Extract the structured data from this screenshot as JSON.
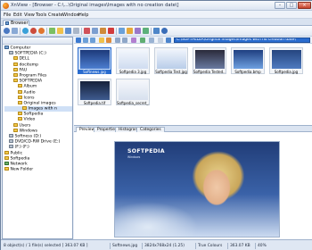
{
  "window": {
    "title": "XnView - [Browser - C:\\...\\Original images\\Images with no creation date\\]"
  },
  "menubar": [
    "File",
    "Edit",
    "View",
    "Tools",
    "Create",
    "Window",
    "Help"
  ],
  "tabs": [
    {
      "label": "Browser"
    }
  ],
  "address": "C:\\SOFTPEDIA\\Original images\\Images with no creation date\\",
  "tree": [
    {
      "label": "Computer",
      "icon": "computer-icon",
      "level": 0
    },
    {
      "label": "SOFTPEDIA (C:)",
      "icon": "drive-icon",
      "level": 1
    },
    {
      "label": "DELL",
      "icon": "folder-icon",
      "level": 2
    },
    {
      "label": "docitemp",
      "icon": "folder-icon",
      "level": 2
    },
    {
      "label": "FAU",
      "icon": "folder-icon",
      "level": 2
    },
    {
      "label": "Program Files",
      "icon": "folder-icon",
      "level": 2
    },
    {
      "label": "SOFTPEDIA",
      "icon": "folder-icon",
      "level": 2
    },
    {
      "label": "Album",
      "icon": "folder-icon",
      "level": 3
    },
    {
      "label": "Audio",
      "icon": "folder-icon",
      "level": 3
    },
    {
      "label": "Icons",
      "icon": "folder-icon",
      "level": 3
    },
    {
      "label": "Original images",
      "icon": "folder-icon",
      "level": 3
    },
    {
      "label": "Images with n",
      "icon": "folder-icon",
      "level": 4,
      "selected": true
    },
    {
      "label": "Softpedia",
      "icon": "folder-icon",
      "level": 3
    },
    {
      "label": "Video",
      "icon": "folder-icon",
      "level": 3
    },
    {
      "label": "Users",
      "icon": "folder-icon",
      "level": 2
    },
    {
      "label": "Windows",
      "icon": "folder-icon",
      "level": 2
    },
    {
      "label": "Softness (D:)",
      "icon": "drive-icon",
      "level": 1
    },
    {
      "label": "DVD/CD-RW Drive (E:)",
      "icon": "drive-icon",
      "level": 1
    },
    {
      "label": "(F:) (F:)",
      "icon": "drive-icon",
      "level": 1
    },
    {
      "label": "Public",
      "icon": "folder-icon",
      "level": 0
    },
    {
      "label": "Softpedia",
      "icon": "folder-icon",
      "level": 0
    },
    {
      "label": "Network",
      "icon": "network-icon",
      "level": 0
    },
    {
      "label": "New Folder",
      "icon": "folder-icon",
      "level": 0
    }
  ],
  "thumbnails": [
    {
      "label": "Softnews.jpg",
      "selected": true
    },
    {
      "label": "Softpedia 3.jpg",
      "selected": false
    },
    {
      "label": "Softpedia Test.jpg",
      "selected": false
    },
    {
      "label": "Softpedia Tested...",
      "selected": false
    },
    {
      "label": "Softpedia.bmp",
      "selected": false
    },
    {
      "label": "Softpedia.jpg",
      "selected": false
    },
    {
      "label": "Softpedia.tif",
      "selected": false
    },
    {
      "label": "Softpedia_secret_...",
      "selected": false
    }
  ],
  "preview_tabs": [
    "Preview",
    "Properties",
    "Histogram",
    "Categories"
  ],
  "preview": {
    "logo": "SOFTPEDIA",
    "tagline": "Windows"
  },
  "status": {
    "selection": "8 object(s) / 1 file(s) selected [ 363.07 KB ]",
    "filename": "Softnews.jpg",
    "dimensions": "3824x768x24 (1.25)",
    "colors": "True Colours",
    "size": "363.07 KB",
    "zoom": "40%"
  },
  "colors": {
    "accent": "#2a6ccf",
    "frame": "#6a7f9c"
  }
}
